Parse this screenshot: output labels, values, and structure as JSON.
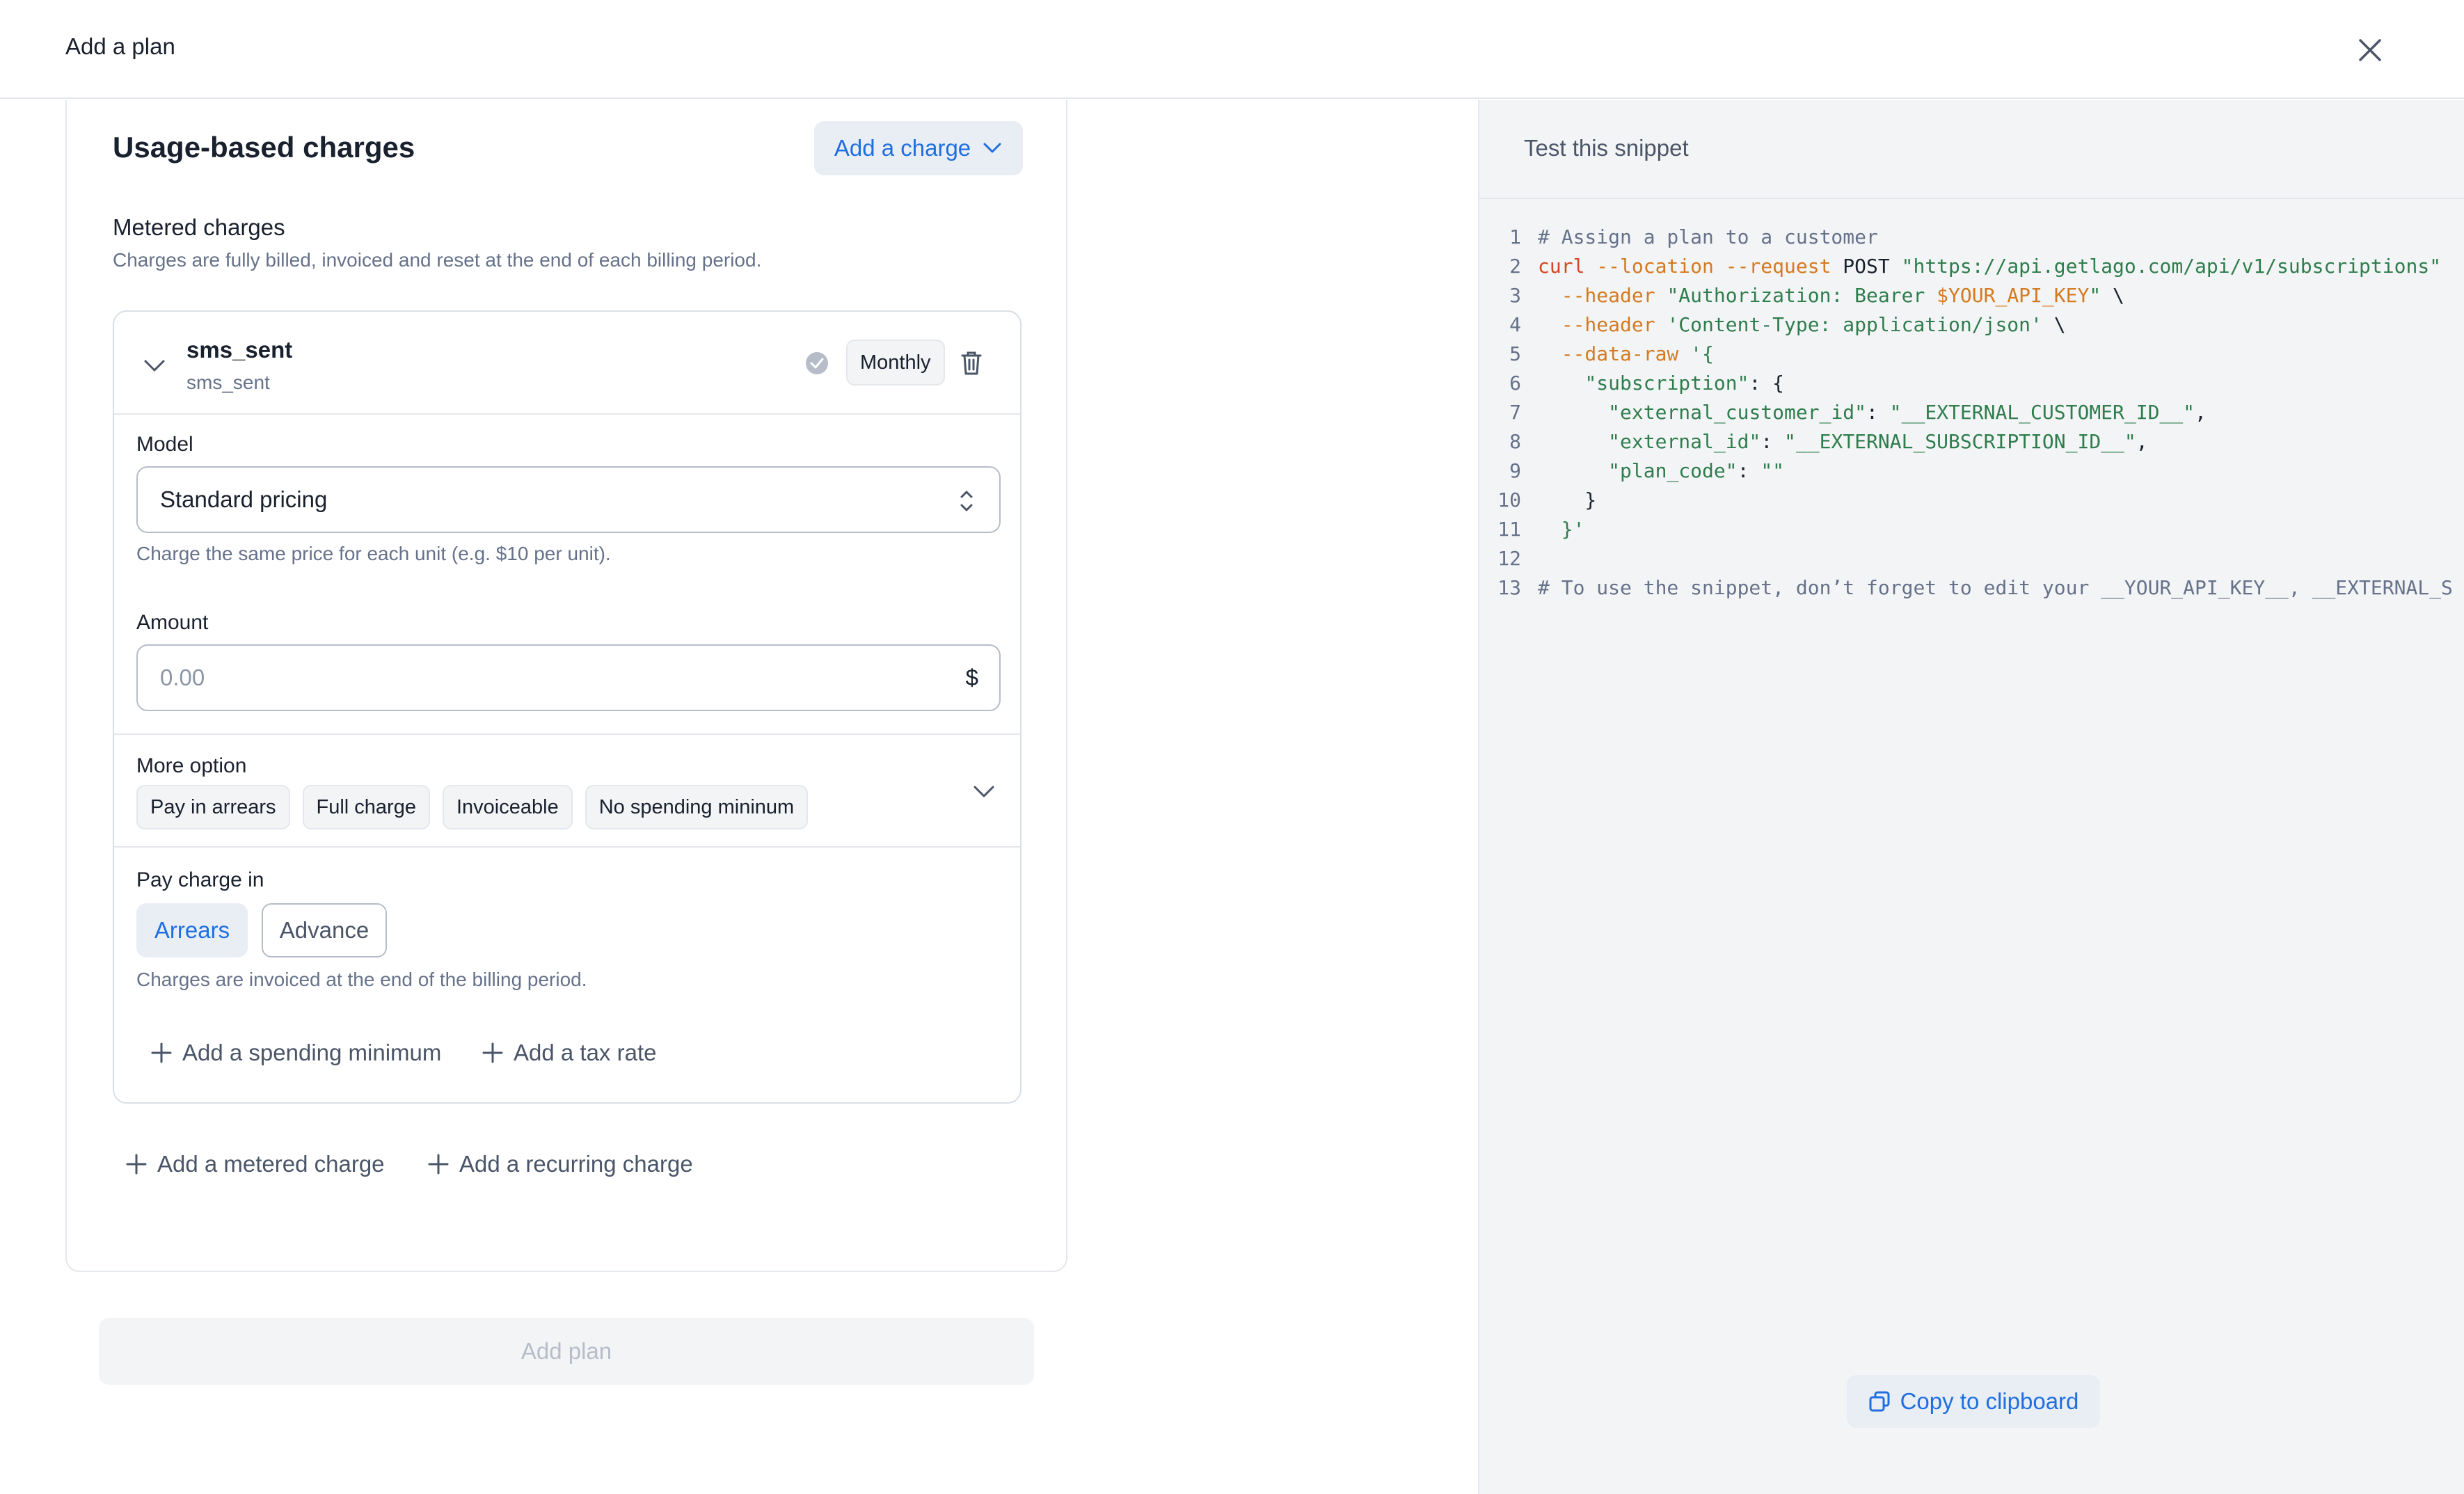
{
  "header": {
    "title": "Add a plan"
  },
  "usage": {
    "title": "Usage-based charges",
    "add_charge_label": "Add a charge",
    "metered_title": "Metered charges",
    "metered_subtitle": "Charges are fully billed, invoiced and reset at the end of each billing period."
  },
  "charge": {
    "name": "sms_sent",
    "code": "sms_sent",
    "interval": "Monthly",
    "model_label": "Model",
    "model_value": "Standard pricing",
    "model_helper": "Charge the same price for each unit (e.g. $10 per unit).",
    "amount_label": "Amount",
    "amount_placeholder": "0.00",
    "currency_symbol": "$",
    "more_label": "More option",
    "tags": [
      "Pay in arrears",
      "Full charge",
      "Invoiceable",
      "No spending mininum"
    ],
    "pay_label": "Pay charge in",
    "pay_options": [
      "Arrears",
      "Advance"
    ],
    "pay_selected": "Arrears",
    "pay_helper": "Charges are invoiced at the end of the billing period.",
    "add_min_label": "Add a spending minimum",
    "add_tax_label": "Add a tax rate"
  },
  "actions": {
    "add_metered_label": "Add a metered charge",
    "add_recurring_label": "Add a recurring charge",
    "add_plan_label": "Add plan"
  },
  "snippet": {
    "title": "Test this snippet",
    "copy_label": "Copy to clipboard",
    "lines": [
      "# Assign a plan to a customer",
      "curl --location --request POST \"https://api.getlago.com/api/v1/subscriptions\"",
      "  --header \"Authorization: Bearer $YOUR_API_KEY\" \\",
      "  --header 'Content-Type: application/json' \\",
      "  --data-raw '{",
      "    \"subscription\": {",
      "      \"external_customer_id\": \"__EXTERNAL_CUSTOMER_ID__\",",
      "      \"external_id\": \"__EXTERNAL_SUBSCRIPTION_ID__\",",
      "      \"plan_code\": \"\"",
      "    }",
      "  }'",
      "",
      "# To use the snippet, don’t forget to edit your __YOUR_API_KEY__, __EXTERNAL_S"
    ]
  },
  "colors": {
    "accent": "#1f6fe0",
    "panel_bg": "#f3f4f6",
    "border": "#e4e7ec",
    "muted_text": "#66728a"
  }
}
